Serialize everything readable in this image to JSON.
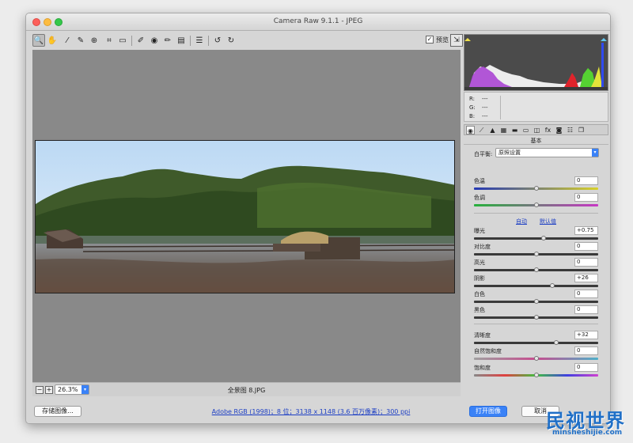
{
  "window": {
    "title": "Camera Raw 9.1.1 -  JPEG"
  },
  "toolbar": {
    "tools": [
      "zoom-icon",
      "hand-icon",
      "white-balance-icon",
      "color-sampler-icon",
      "target-adjust-icon",
      "crop-icon",
      "straighten-icon",
      "spot-removal-icon",
      "red-eye-icon",
      "adjustment-brush-icon",
      "graduated-filter-icon",
      "preferences-icon",
      "rotate-ccw-icon",
      "rotate-cw-icon"
    ],
    "preview_label": "预览",
    "preview_checked": "✓"
  },
  "status": {
    "zoom_out": "−",
    "zoom_in": "+",
    "zoom_value": "26.3%",
    "filename": "全景图 8.JPG"
  },
  "bottom": {
    "save_label": "存储图像...",
    "color_info": "Adobe RGB (1998)；8 位；3138 x 1148 (3.6 百万像素)；300 ppi",
    "open_label": "打开图像",
    "cancel_label": "取消"
  },
  "readout": {
    "r": "R:",
    "g": "G:",
    "b": "B:",
    "r_val": "---",
    "g_val": "---",
    "b_val": "---"
  },
  "panel": {
    "header": "基本",
    "wb_label": "白平衡:",
    "wb_value": "原照设置",
    "auto": "自动",
    "default": "默认值",
    "sliders": [
      {
        "label": "色温",
        "value": "0",
        "pos": 0.5
      },
      {
        "label": "色调",
        "value": "0",
        "pos": 0.5
      },
      {
        "label": "曝光",
        "value": "+0.75",
        "pos": 0.56
      },
      {
        "label": "对比度",
        "value": "0",
        "pos": 0.5
      },
      {
        "label": "高光",
        "value": "0",
        "pos": 0.5
      },
      {
        "label": "阴影",
        "value": "+26",
        "pos": 0.63
      },
      {
        "label": "白色",
        "value": "0",
        "pos": 0.5
      },
      {
        "label": "黑色",
        "value": "0",
        "pos": 0.5
      },
      {
        "label": "清晰度",
        "value": "+32",
        "pos": 0.66
      },
      {
        "label": "自然饱和度",
        "value": "0",
        "pos": 0.5
      },
      {
        "label": "饱和度",
        "value": "0",
        "pos": 0.5
      }
    ]
  },
  "watermark": {
    "title": "民视世界",
    "url": "minsheshijie.com"
  }
}
